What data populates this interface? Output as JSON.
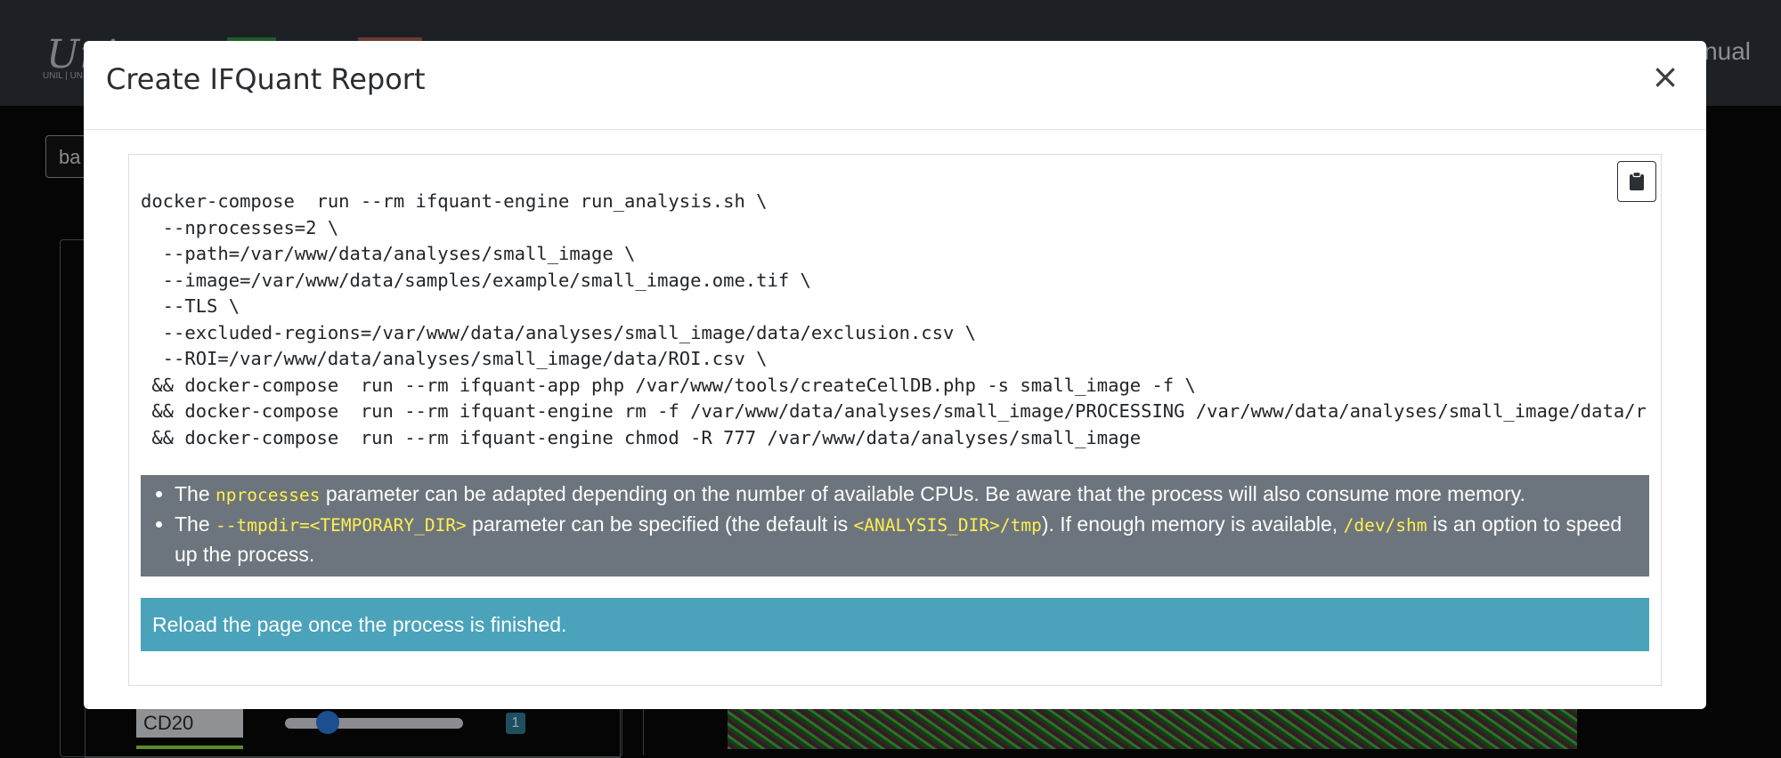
{
  "background": {
    "logo_text": "Uni",
    "logo_sub": "UNIL | UN",
    "nav_manual": "nual",
    "search_value": "ba",
    "marker_label": "CD20",
    "marker_badge": "1"
  },
  "modal": {
    "title": "Create IFQuant Report",
    "close_symbol": "×",
    "copy_button_icon": "clipboard-icon",
    "command_lines": [
      "docker-compose  run --rm ifquant-engine run_analysis.sh \\",
      "  --nprocesses=2 \\",
      "  --path=/var/www/data/analyses/small_image \\",
      "  --image=/var/www/data/samples/example/small_image.ome.tif \\",
      "  --TLS \\",
      "  --excluded-regions=/var/www/data/analyses/small_image/data/exclusion.csv \\",
      "  --ROI=/var/www/data/analyses/small_image/data/ROI.csv \\",
      " && docker-compose  run --rm ifquant-app php /var/www/tools/createCellDB.php -s small_image -f \\",
      " && docker-compose  run --rm ifquant-engine rm -f /var/www/data/analyses/small_image/PROCESSING /var/www/data/analyses/small_image/data/run_analysis.sh",
      " && docker-compose  run --rm ifquant-engine chmod -R 777 /var/www/data/analyses/small_image"
    ],
    "notes": [
      {
        "prefix": "The ",
        "code": "nprocesses",
        "suffix": " parameter can be adapted depending on the number of available CPUs. Be aware that the process will also consume more memory."
      },
      {
        "prefix": "The ",
        "code": "--tmpdir=<TEMPORARY_DIR>",
        "mid1": " parameter can be specified (the default is ",
        "code2": "<ANALYSIS_DIR>/tmp",
        "mid2": "). If enough memory is available, ",
        "code3": "/dev/shm",
        "suffix": " is an option to speed up the process."
      }
    ],
    "info_text": "Reload the page once the process is finished."
  },
  "colors": {
    "note_background": "#6c757d",
    "note_code": "#ffee4f",
    "info_background": "#4aa3bb"
  }
}
